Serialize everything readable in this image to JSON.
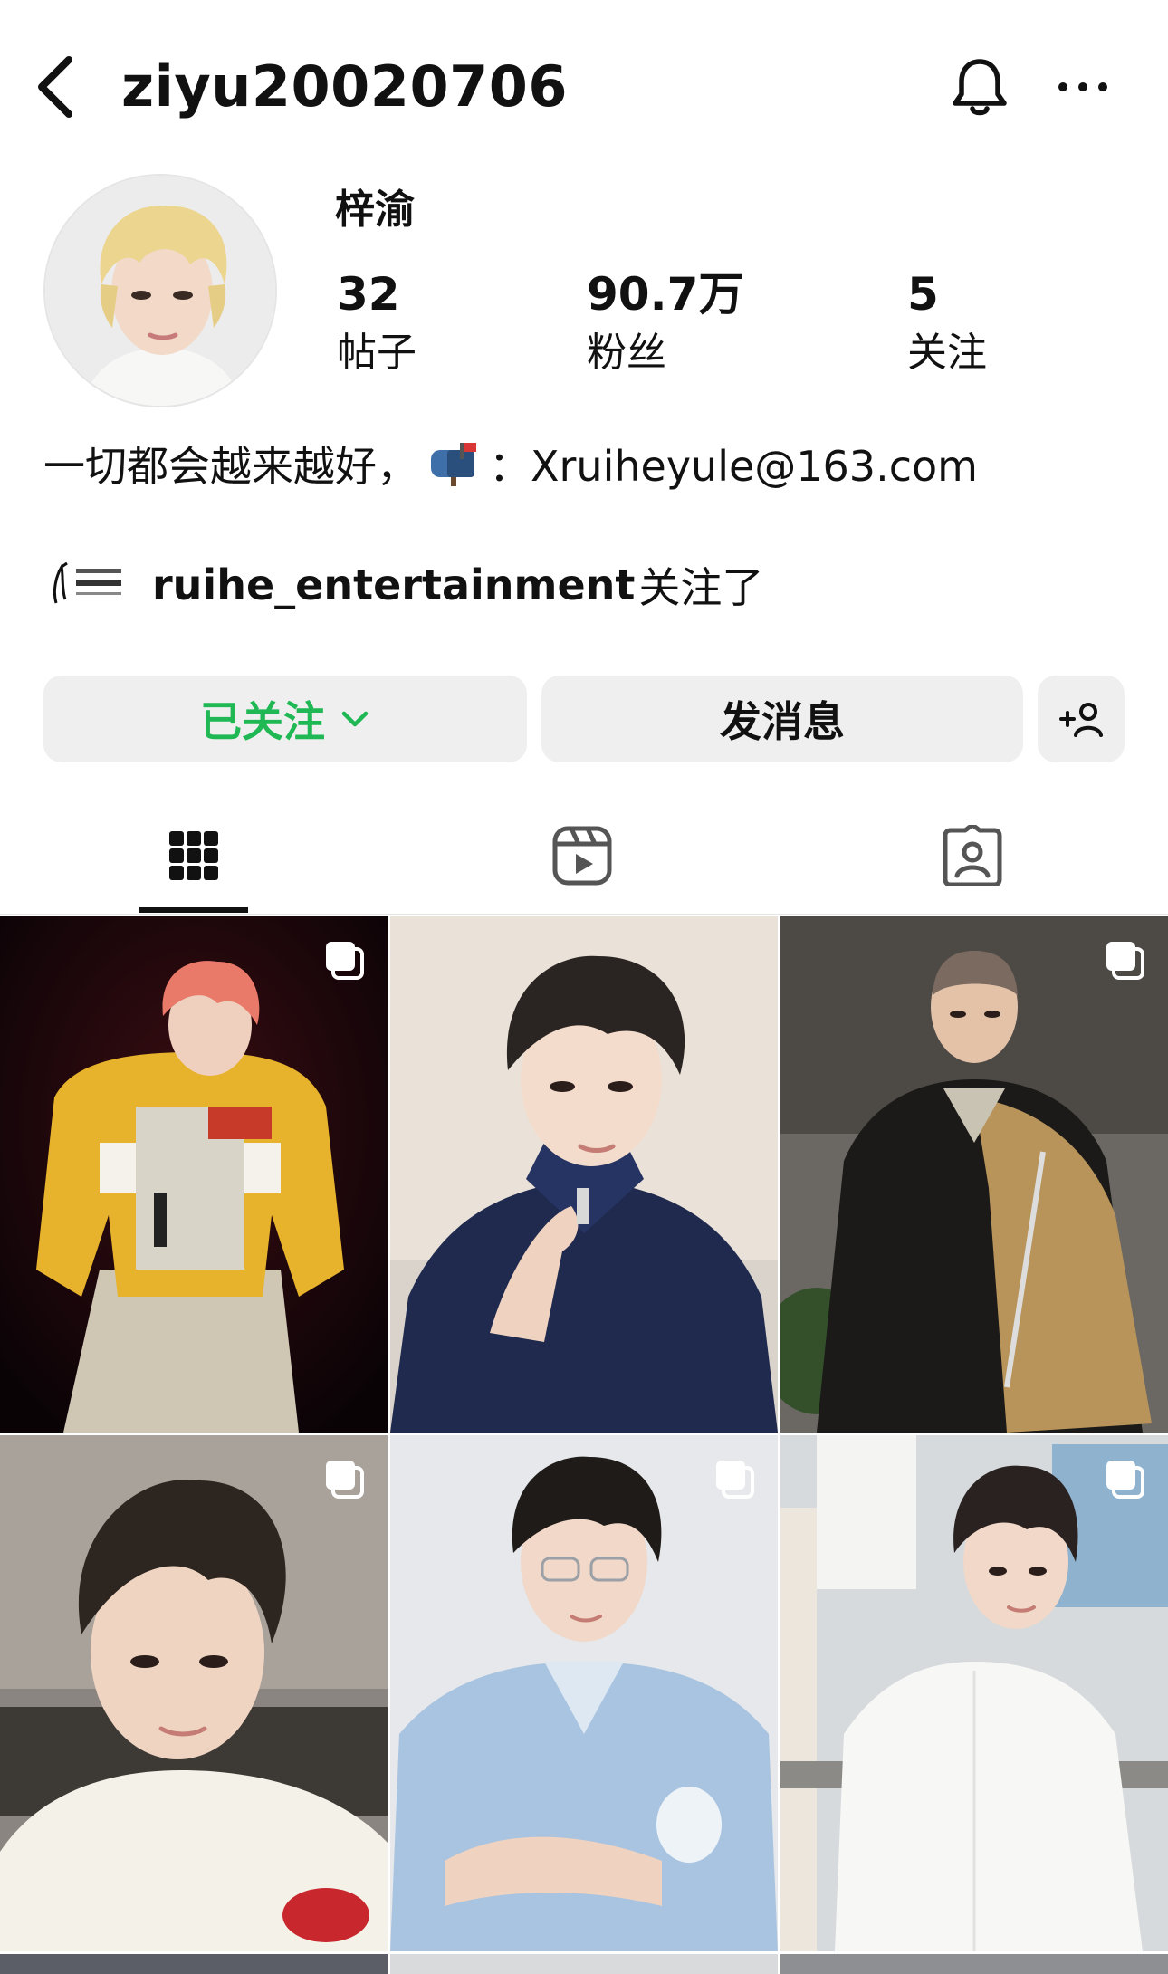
{
  "header": {
    "username": "ziyu20020706",
    "back_icon": "chevron-left-icon",
    "bell_icon": "bell-icon",
    "more_icon": "more-horizontal-icon"
  },
  "profile": {
    "display_name": "梓渝",
    "stats": [
      {
        "value": "32",
        "label": "帖子"
      },
      {
        "value": "90.7万",
        "label": "粉丝"
      },
      {
        "value": "5",
        "label": "关注"
      }
    ],
    "bio_prefix": "一切都会越来越好，",
    "bio_email": "：Xruiheyule@163.com",
    "followed_by_user": "ruihe_entertainment",
    "followed_by_suffix": "关注了"
  },
  "buttons": {
    "following": "已关注",
    "message": "发消息",
    "add_user_icon": "add-user-icon"
  },
  "tabs": [
    {
      "icon": "grid-icon",
      "active": true
    },
    {
      "icon": "reels-icon",
      "active": false
    },
    {
      "icon": "tagged-icon",
      "active": false
    }
  ],
  "posts": [
    {
      "multi": true
    },
    {
      "multi": false
    },
    {
      "multi": true
    },
    {
      "multi": true
    },
    {
      "multi": true
    },
    {
      "multi": true
    }
  ],
  "colors": {
    "following_green": "#1fb855",
    "button_bg": "#efeff0"
  }
}
